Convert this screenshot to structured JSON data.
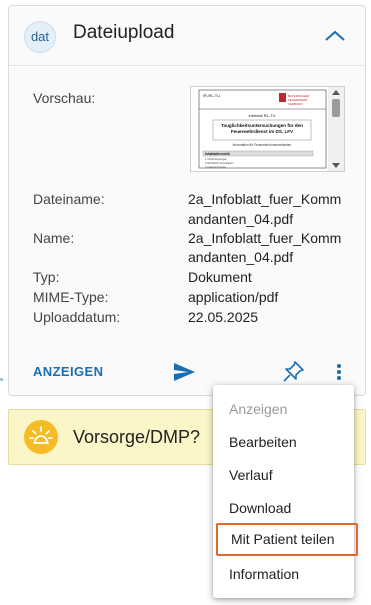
{
  "card": {
    "avatar_text": "dat",
    "title": "Dateiupload",
    "fields": {
      "preview_label": "Vorschau:",
      "filename_label": "Dateiname:",
      "filename_line1": "2a_Infoblatt_fuer_Komm",
      "filename_line2": "andanten_04.pdf",
      "name_label": "Name:",
      "name_line1": "2a_Infoblatt_fuer_Komm",
      "name_line2": "andanten_04.pdf",
      "type_label": "Typ:",
      "type_value": "Dokument",
      "mime_label": "MIME-Type:",
      "mime_value": "application/pdf",
      "date_label": "Uploaddatum:",
      "date_value": "22.05.2025"
    },
    "preview": {
      "header_left": "IR-RL-TU",
      "header_right_line1": "BAYERISCHER",
      "header_right_line2": "FEUERWEHR",
      "header_right_line3": "VERBAND",
      "subtitle": "Infoblatt RL-TU",
      "title_line1": "Tauglichkeitsuntersuchungen für den",
      "title_line2": "Feuerwehrdienst im DS. LFV",
      "info_text": "Information für Feuerwehrkommandanten",
      "toc_heading": "Inhaltsübersicht",
      "toc_items": [
        "1 Vorbemerkungen",
        "2 Rechtliche Grundlagen",
        "3 Untersuchungen"
      ]
    },
    "footer": {
      "view_label": "ANZEIGEN"
    }
  },
  "vorsorge": {
    "label": "Vorsorge/DMP?"
  },
  "menu": {
    "items": [
      {
        "label": "Anzeigen"
      },
      {
        "label": "Bearbeiten"
      },
      {
        "label": "Verlauf"
      },
      {
        "label": "Download"
      },
      {
        "label": "Mit Patient teilen"
      },
      {
        "label": "Information"
      }
    ]
  },
  "colors": {
    "accent": "#1a6fb4",
    "highlight_border": "#e06a2c",
    "vorsorge_bg": "#fbf6c8",
    "bulb": "#f6bc25"
  }
}
